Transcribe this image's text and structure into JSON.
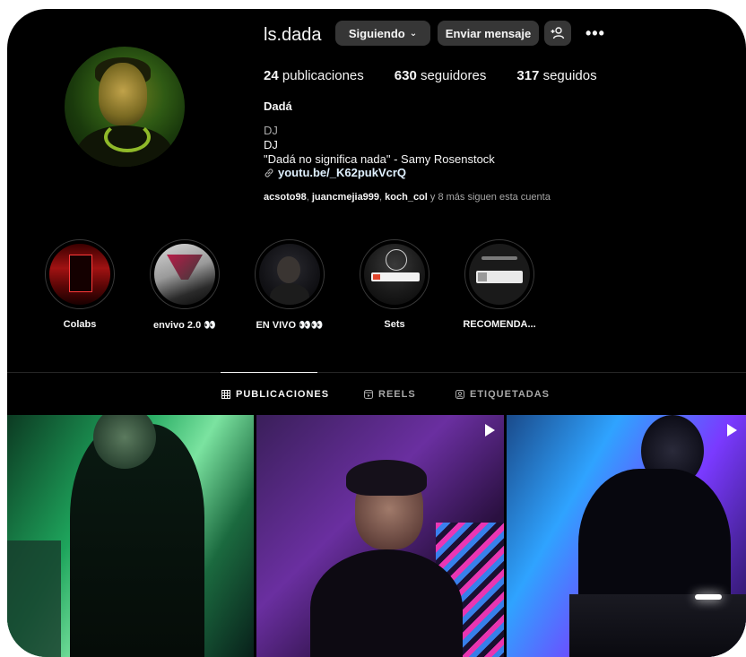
{
  "profile": {
    "username": "ls.dada",
    "following_button": "Siguiendo",
    "message_button": "Enviar mensaje",
    "more_label": "•••",
    "stats": {
      "posts_count": "24",
      "posts_label": "publicaciones",
      "followers_count": "630",
      "followers_label": "seguidores",
      "following_count": "317",
      "following_label": "seguidos"
    },
    "name": "Dadá",
    "bio_line1": "DJ",
    "bio_line2": "DJ",
    "bio_line3": "\"Dadá no significa nada\" - Samy Rosenstock",
    "link": "youtu.be/_K62pukVcrQ",
    "followed_by": {
      "user1": "acsoto98",
      "user2": "juancmejia999",
      "user3": "koch_col",
      "rest": " y 8 más siguen esta cuenta"
    }
  },
  "highlights": [
    {
      "label": "Colabs"
    },
    {
      "label": "envivo 2.0 👀"
    },
    {
      "label": "EN VIVO 👀👀"
    },
    {
      "label": "Sets"
    },
    {
      "label": "RECOMENDA..."
    }
  ],
  "tabs": {
    "posts": "PUBLICACIONES",
    "reels": "REELS",
    "tagged": "ETIQUETADAS"
  },
  "colors": {
    "background": "#000000",
    "button": "#363636",
    "muted_text": "#a8a8a8",
    "link_text": "#e0f1ff"
  }
}
